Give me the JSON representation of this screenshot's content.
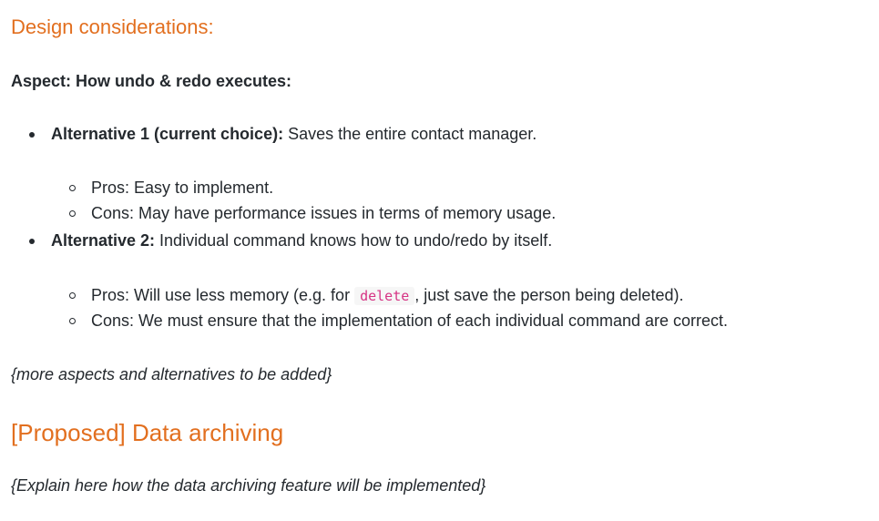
{
  "design_heading": "Design considerations:",
  "aspect_heading": "Aspect: How undo & redo executes:",
  "alternatives": [
    {
      "label": "Alternative 1 (current choice):",
      "text": " Saves the entire contact manager.",
      "pros": "Pros: Easy to implement.",
      "cons": "Cons: May have performance issues in terms of memory usage."
    },
    {
      "label": "Alternative 2:",
      "text": " Individual command knows how to undo/redo by itself.",
      "pros_before": "Pros: Will use less memory (e.g. for ",
      "pros_code": "delete",
      "pros_after": ", just save the person being deleted).",
      "cons": "Cons: We must ensure that the implementation of each individual command are correct."
    }
  ],
  "more_aspects_note": "{more aspects and alternatives to be added}",
  "proposed_heading": "[Proposed] Data archiving",
  "explain_note": "{Explain here how the data archiving feature will be implemented}"
}
